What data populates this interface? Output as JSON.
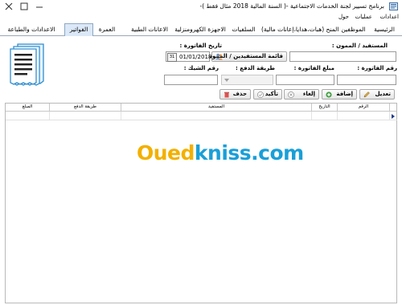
{
  "window": {
    "title": "برنامج تسيير لجنة الخدمات الاجتماعية -( السنة المالية 2018 مثال فقط )-",
    "minimize_icon": "minimize-icon",
    "maximize_icon": "maximize-icon",
    "close_icon": "close-icon"
  },
  "menu": {
    "items": [
      "اعدادات",
      "عمليات",
      "حول"
    ]
  },
  "tabs": {
    "items": [
      "الرئيسية",
      "الموظفين",
      "المنح (هبات،هدايا،إعانات مالية)",
      "السلفيات",
      "الاجهزة الكهرومنزلية",
      "الاعانات الطبية",
      "العمرة",
      "الفواتير",
      "الاعدادات والطباعة"
    ],
    "active": "الفواتير"
  },
  "form": {
    "beneficiary_label": "المستفيد / الممون :",
    "beneficiary_value": "",
    "invoice_date_label": "تاريخ الفاتورة :",
    "invoice_date_value": "01/01/2018",
    "calendar_icon_text": "31",
    "beneficiaries_list_button": "قائمة المستفيدين / الممونين",
    "invoice_number_label": "رقم الفاتورة :",
    "invoice_number_value": "",
    "invoice_amount_label": "مبلغ الفاتورة :",
    "invoice_amount_value": "",
    "payment_method_label": "طريقة الدفع :",
    "payment_method_value": "",
    "check_number_label": "رقم الشيك :",
    "check_number_value": ""
  },
  "actions": {
    "edit": "تعديل",
    "add": "إضافة",
    "cancel": "إلغاء",
    "confirm": "تأكيد",
    "delete": "حذف"
  },
  "table": {
    "columns": [
      "الرقم",
      "التاريخ",
      "المستفيد",
      "طريقة الدفع",
      "المبلغ"
    ]
  },
  "watermark": {
    "part1": "Oued",
    "part2": "kniss",
    "part3": ".com",
    "color1": "#f3b000",
    "color2": "#1a9fd8"
  }
}
